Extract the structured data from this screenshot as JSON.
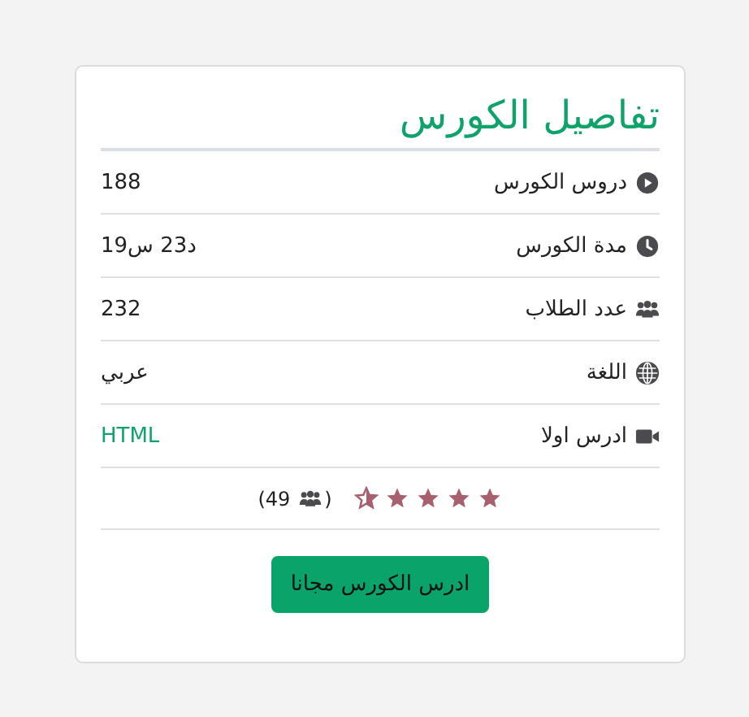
{
  "title": "تفاصيل الكورس",
  "rows": [
    {
      "label": "دروس الكورس",
      "value": "188",
      "kind": "text"
    },
    {
      "label": "مدة الكورس",
      "value": "د23 س19",
      "kind": "text"
    },
    {
      "label": "عدد الطلاب",
      "value": "232",
      "kind": "text"
    },
    {
      "label": "اللغة",
      "value": "عربي",
      "kind": "text"
    },
    {
      "label": "ادرس اولا",
      "value": "HTML",
      "kind": "link"
    }
  ],
  "rating": {
    "stars": 4.5,
    "count_open": "(49",
    "count_close": ")"
  },
  "button": "ادرس الكورس مجانا"
}
